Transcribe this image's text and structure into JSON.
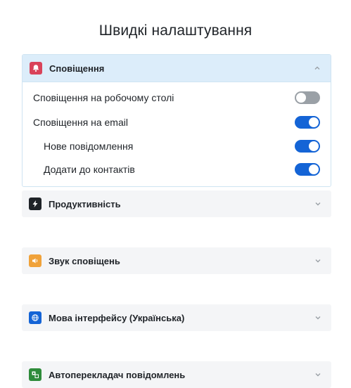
{
  "page": {
    "title": "Швидкі налаштування"
  },
  "sections": {
    "notifications": {
      "label": "Сповіщення",
      "icon": "bell-icon",
      "color": "#d9435a",
      "expanded": true,
      "settings": [
        {
          "label": "Сповіщення на робочому столі",
          "on": false
        },
        {
          "label": "Сповіщення на email",
          "on": true
        },
        {
          "label": "Нове повідомлення",
          "on": true
        },
        {
          "label": "Додати до контактів",
          "on": true
        }
      ]
    },
    "productivity": {
      "label": "Продуктивність",
      "icon": "lightning-icon",
      "color": "#1f2328",
      "expanded": false
    },
    "sound": {
      "label": "Звук сповіщень",
      "icon": "speaker-icon",
      "color": "#f0a23a",
      "expanded": false
    },
    "language": {
      "label": "Мова інтерфейсу (Українська)",
      "icon": "globe-icon",
      "color": "#1464d6",
      "expanded": false
    },
    "translate": {
      "label": "Автоперекладач повідомлень",
      "icon": "translate-icon",
      "color": "#2e8b3a",
      "expanded": false
    }
  },
  "colors": {
    "toggle_on": "#1464d6",
    "toggle_off": "#9aa0a6",
    "header_active_bg": "#dcedfa"
  }
}
